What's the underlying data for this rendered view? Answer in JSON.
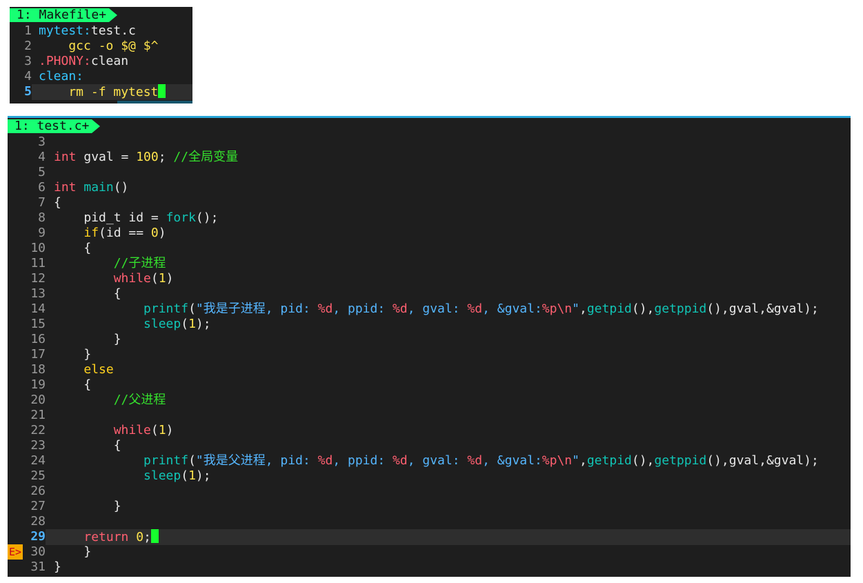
{
  "makefile_pane": {
    "tab_label": "1: Makefile+",
    "lines": [
      {
        "n": "1",
        "current": false,
        "tokens": [
          {
            "t": "mytest:",
            "c": "target"
          },
          {
            "t": "test.c",
            "c": ""
          }
        ]
      },
      {
        "n": "2",
        "current": false,
        "tokens": [
          {
            "t": "    gcc -o ",
            "c": "var"
          },
          {
            "t": "$@ $^",
            "c": "var"
          }
        ]
      },
      {
        "n": "3",
        "current": false,
        "tokens": [
          {
            "t": ".PHONY:",
            "c": "phony"
          },
          {
            "t": "clean",
            "c": ""
          }
        ]
      },
      {
        "n": "4",
        "current": false,
        "tokens": [
          {
            "t": "clean:",
            "c": "target"
          }
        ]
      },
      {
        "n": "5",
        "current": true,
        "cursor": true,
        "tokens": [
          {
            "t": "    rm -f mytest",
            "c": "var"
          }
        ]
      }
    ]
  },
  "test_pane": {
    "tab_label": "1: test.c+",
    "lines": [
      {
        "n": "3",
        "tokens": []
      },
      {
        "n": "4",
        "tokens": [
          {
            "t": "int",
            "c": "type"
          },
          {
            "t": " gval = ",
            "c": ""
          },
          {
            "t": "100",
            "c": "num"
          },
          {
            "t": "; ",
            "c": ""
          },
          {
            "t": "//全局变量",
            "c": "cmt"
          }
        ]
      },
      {
        "n": "5",
        "tokens": []
      },
      {
        "n": "6",
        "tokens": [
          {
            "t": "int",
            "c": "type"
          },
          {
            "t": " ",
            "c": ""
          },
          {
            "t": "main",
            "c": "fn"
          },
          {
            "t": "()",
            "c": ""
          }
        ]
      },
      {
        "n": "7",
        "tokens": [
          {
            "t": "{",
            "c": ""
          }
        ]
      },
      {
        "n": "8",
        "tokens": [
          {
            "t": "    pid_t id = ",
            "c": ""
          },
          {
            "t": "fork",
            "c": "fn"
          },
          {
            "t": "();",
            "c": ""
          }
        ]
      },
      {
        "n": "9",
        "tokens": [
          {
            "t": "    ",
            "c": ""
          },
          {
            "t": "if",
            "c": "cond"
          },
          {
            "t": "(id == ",
            "c": ""
          },
          {
            "t": "0",
            "c": "num"
          },
          {
            "t": ")",
            "c": ""
          }
        ]
      },
      {
        "n": "10",
        "tokens": [
          {
            "t": "    {",
            "c": ""
          }
        ]
      },
      {
        "n": "11",
        "tokens": [
          {
            "t": "        ",
            "c": ""
          },
          {
            "t": "//子进程",
            "c": "cmt"
          }
        ]
      },
      {
        "n": "12",
        "tokens": [
          {
            "t": "        ",
            "c": ""
          },
          {
            "t": "while",
            "c": "kw"
          },
          {
            "t": "(",
            "c": ""
          },
          {
            "t": "1",
            "c": "num"
          },
          {
            "t": ")",
            "c": ""
          }
        ]
      },
      {
        "n": "13",
        "tokens": [
          {
            "t": "        {",
            "c": ""
          }
        ]
      },
      {
        "n": "14",
        "tokens": [
          {
            "t": "            ",
            "c": ""
          },
          {
            "t": "printf",
            "c": "fn"
          },
          {
            "t": "(",
            "c": ""
          },
          {
            "t": "\"我是子进程, pid: ",
            "c": "str"
          },
          {
            "t": "%d",
            "c": "fmt"
          },
          {
            "t": ", ppid: ",
            "c": "str"
          },
          {
            "t": "%d",
            "c": "fmt"
          },
          {
            "t": ", gval: ",
            "c": "str"
          },
          {
            "t": "%d",
            "c": "fmt"
          },
          {
            "t": ", &gval:",
            "c": "str"
          },
          {
            "t": "%p\\n",
            "c": "fmt"
          },
          {
            "t": "\"",
            "c": "str"
          },
          {
            "t": ",",
            "c": ""
          },
          {
            "t": "getpid",
            "c": "fn"
          },
          {
            "t": "(),",
            "c": ""
          },
          {
            "t": "getppid",
            "c": "fn"
          },
          {
            "t": "(),gval,&gval);",
            "c": ""
          }
        ]
      },
      {
        "n": "15",
        "tokens": [
          {
            "t": "            ",
            "c": ""
          },
          {
            "t": "sleep",
            "c": "fn"
          },
          {
            "t": "(",
            "c": ""
          },
          {
            "t": "1",
            "c": "num"
          },
          {
            "t": ");",
            "c": ""
          }
        ]
      },
      {
        "n": "16",
        "tokens": [
          {
            "t": "        }",
            "c": ""
          }
        ]
      },
      {
        "n": "17",
        "tokens": [
          {
            "t": "    }",
            "c": ""
          }
        ]
      },
      {
        "n": "18",
        "tokens": [
          {
            "t": "    ",
            "c": ""
          },
          {
            "t": "else",
            "c": "cond"
          }
        ]
      },
      {
        "n": "19",
        "tokens": [
          {
            "t": "    {",
            "c": ""
          }
        ]
      },
      {
        "n": "20",
        "tokens": [
          {
            "t": "        ",
            "c": ""
          },
          {
            "t": "//父进程",
            "c": "cmt"
          }
        ]
      },
      {
        "n": "21",
        "tokens": []
      },
      {
        "n": "22",
        "tokens": [
          {
            "t": "        ",
            "c": ""
          },
          {
            "t": "while",
            "c": "kw"
          },
          {
            "t": "(",
            "c": ""
          },
          {
            "t": "1",
            "c": "num"
          },
          {
            "t": ")",
            "c": ""
          }
        ]
      },
      {
        "n": "23",
        "tokens": [
          {
            "t": "        {",
            "c": ""
          }
        ]
      },
      {
        "n": "24",
        "tokens": [
          {
            "t": "            ",
            "c": ""
          },
          {
            "t": "printf",
            "c": "fn"
          },
          {
            "t": "(",
            "c": ""
          },
          {
            "t": "\"我是父进程, pid: ",
            "c": "str"
          },
          {
            "t": "%d",
            "c": "fmt"
          },
          {
            "t": ", ppid: ",
            "c": "str"
          },
          {
            "t": "%d",
            "c": "fmt"
          },
          {
            "t": ", gval: ",
            "c": "str"
          },
          {
            "t": "%d",
            "c": "fmt"
          },
          {
            "t": ", &gval:",
            "c": "str"
          },
          {
            "t": "%p\\n",
            "c": "fmt"
          },
          {
            "t": "\"",
            "c": "str"
          },
          {
            "t": ",",
            "c": ""
          },
          {
            "t": "getpid",
            "c": "fn"
          },
          {
            "t": "(),",
            "c": ""
          },
          {
            "t": "getppid",
            "c": "fn"
          },
          {
            "t": "(),gval,&gval);",
            "c": ""
          }
        ]
      },
      {
        "n": "25",
        "tokens": [
          {
            "t": "            ",
            "c": ""
          },
          {
            "t": "sleep",
            "c": "fn"
          },
          {
            "t": "(",
            "c": ""
          },
          {
            "t": "1",
            "c": "num"
          },
          {
            "t": ");",
            "c": ""
          }
        ]
      },
      {
        "n": "26",
        "tokens": []
      },
      {
        "n": "27",
        "tokens": [
          {
            "t": "        }",
            "c": ""
          }
        ]
      },
      {
        "n": "28",
        "tokens": []
      },
      {
        "n": "29",
        "current": true,
        "cursor": true,
        "tokens": [
          {
            "t": "    ",
            "c": ""
          },
          {
            "t": "return",
            "c": "kw"
          },
          {
            "t": " ",
            "c": ""
          },
          {
            "t": "0",
            "c": "num"
          },
          {
            "t": ";",
            "c": ""
          }
        ]
      },
      {
        "n": "30",
        "sign": "E>",
        "tokens": [
          {
            "t": "    }",
            "c": ""
          }
        ]
      },
      {
        "n": "31",
        "tokens": [
          {
            "t": "}",
            "c": ""
          }
        ]
      }
    ]
  },
  "colors": {
    "background": "#1e1e1e",
    "tab_bg": "#17ff73",
    "cursor": "#17ff2e",
    "keyword": "#ff5f70",
    "function": "#11c5b6",
    "string": "#55b6ff",
    "number": "#ffe44d",
    "comment": "#35e02d",
    "error_sign_bg": "#f6a800"
  }
}
